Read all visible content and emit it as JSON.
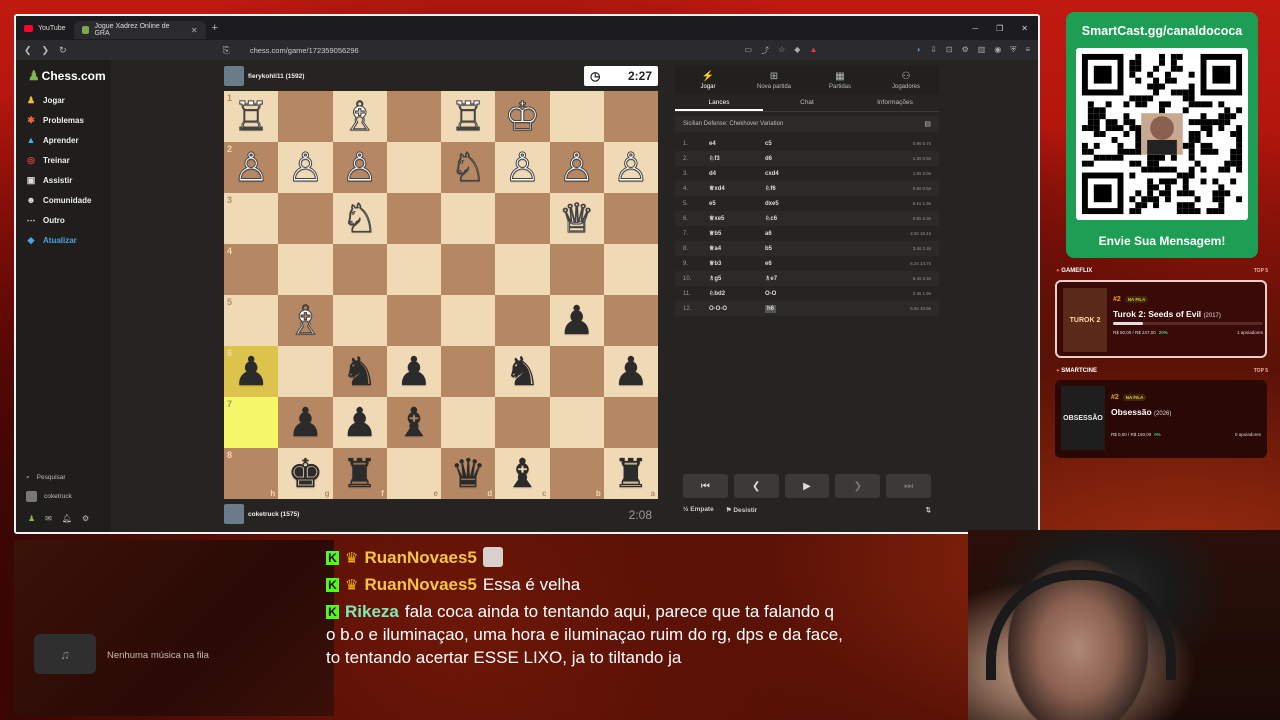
{
  "browser": {
    "tabs": [
      {
        "label": "YouTube"
      },
      {
        "label": "Jogue Xadrez Online de GRA"
      }
    ],
    "url": "chess.com/game/172359056296"
  },
  "sidebar": {
    "logo": "Chess.com",
    "items": [
      {
        "label": "Jogar",
        "icon": "pawn-icon"
      },
      {
        "label": "Problemas",
        "icon": "puzzle-icon"
      },
      {
        "label": "Aprender",
        "icon": "learn-icon"
      },
      {
        "label": "Treinar",
        "icon": "target-icon"
      },
      {
        "label": "Assistir",
        "icon": "tv-icon"
      },
      {
        "label": "Comunidade",
        "icon": "community-icon"
      },
      {
        "label": "Outro",
        "icon": "more-icon"
      },
      {
        "label": "Atualizar",
        "icon": "diamond-icon"
      }
    ],
    "search": "Pesquisar",
    "user": "coketruck"
  },
  "game": {
    "top_player": "fierykohli11 (1592)",
    "top_clock": "2:27",
    "bottom_player": "coketruck (1575)",
    "bottom_clock": "2:08",
    "board": [
      [
        "wR",
        "",
        "wB",
        "",
        "wR",
        "wK",
        "",
        ""
      ],
      [
        "wP",
        "wP",
        "wP",
        "",
        "wN",
        "wP",
        "wP",
        "wP"
      ],
      [
        "",
        "",
        "wN",
        "",
        "",
        "",
        "wQ",
        ""
      ],
      [
        "",
        "",
        "",
        "",
        "",
        "",
        "",
        ""
      ],
      [
        "",
        "wB",
        "",
        "",
        "",
        "",
        "bP",
        ""
      ],
      [
        "bP",
        "",
        "bN",
        "bP",
        "",
        "bN",
        "",
        "bP"
      ],
      [
        "",
        "bP",
        "bP",
        "bB",
        "",
        "",
        "",
        ""
      ],
      [
        "",
        "bK",
        "bR",
        "",
        "bQ",
        "bB",
        "",
        "bR"
      ]
    ],
    "ranks": [
      "1",
      "2",
      "3",
      "4",
      "5",
      "6",
      "7",
      "8"
    ],
    "files": [
      "h",
      "g",
      "f",
      "e",
      "d",
      "c",
      "b",
      "a"
    ],
    "highlight": [
      [
        5,
        0
      ],
      [
        6,
        0
      ]
    ]
  },
  "panel": {
    "tabs": [
      {
        "label": "Jogar"
      },
      {
        "label": "Nova partida"
      },
      {
        "label": "Partidas"
      },
      {
        "label": "Jogadores"
      }
    ],
    "subtabs": [
      {
        "label": "Lances"
      },
      {
        "label": "Chat"
      },
      {
        "label": "Informações"
      }
    ],
    "opening": "Sicilian Defense: Chekhover Variation",
    "moves": [
      {
        "n": "1.",
        "w": "e4",
        "b": "c5",
        "t": "0.9s 0.7s"
      },
      {
        "n": "2.",
        "w": "♘f3",
        "b": "d6",
        "t": "1.3s 0.5s"
      },
      {
        "n": "3.",
        "w": "d4",
        "b": "cxd4",
        "t": "1.0s 2.0s"
      },
      {
        "n": "4.",
        "w": "♕xd4",
        "b": "♘f6",
        "t": "0.8s 0.5s"
      },
      {
        "n": "5.",
        "w": "e5",
        "b": "dxe5",
        "t": "5.1s 1.9s"
      },
      {
        "n": "6.",
        "w": "♕xe5",
        "b": "♘c6",
        "t": "0.8s 2.3s"
      },
      {
        "n": "7.",
        "w": "♕b5",
        "b": "a6",
        "t": "2.3s 10.1s"
      },
      {
        "n": "8.",
        "w": "♕a4",
        "b": "b5",
        "t": "3.4s 2.4s"
      },
      {
        "n": "9.",
        "w": "♕b3",
        "b": "e6",
        "t": "6.2s 14.7s"
      },
      {
        "n": "10.",
        "w": "♗g5",
        "b": "♗e7",
        "t": "5.4s 2.4s"
      },
      {
        "n": "11.",
        "w": "♘bd2",
        "b": "O-O",
        "t": "2.3s 1.9s"
      },
      {
        "n": "12.",
        "w": "O-O-O",
        "b": "h6",
        "t": "5.5s 10.9s"
      }
    ],
    "draw": "Empate",
    "resign": "Desistir"
  },
  "smartcast": {
    "title": "SmartCast.gg/canaldococa",
    "message": "Envie Sua Mensagem!"
  },
  "gameflix": {
    "section": "GAMEFLIX",
    "top": "TOP 5",
    "rank": "#2",
    "queue": "NA FILA",
    "title": "Turok 2: Seeds of Evil",
    "year": "(2017)",
    "poster": "TUROK 2",
    "price": "R$ 50,00 / R$ 247,00",
    "pct": "20%",
    "progress": 0.2,
    "supporters": "1 apoiadores"
  },
  "smartcine": {
    "section": "SMARTCINE",
    "top": "TOP 5",
    "rank": "#2",
    "queue": "NA FILA",
    "title": "Obsessão",
    "year": "(2026)",
    "poster": "OBSESSÃO",
    "price": "R$ 0,00 / R$ 150,00",
    "pct": "0%",
    "progress": 0,
    "supporters": "0 apoiadores"
  },
  "music": {
    "text": "Nenhuma música na fila"
  },
  "chat": [
    {
      "user": "RuanNovaes5",
      "color": "#f5c542",
      "text": ""
    },
    {
      "user": "RuanNovaes5",
      "color": "#f5c542",
      "text": "Essa é velha"
    },
    {
      "user": "Rikeza",
      "color": "#7fe8b8",
      "text": "fala coca ainda to tentando aqui, parece que ta falando q o b.o e iluminaçao, uma hora e iluminaçao ruim do rg, dps e da face, to tentando acertar ESSE LIXO, ja to tiltando ja"
    }
  ]
}
